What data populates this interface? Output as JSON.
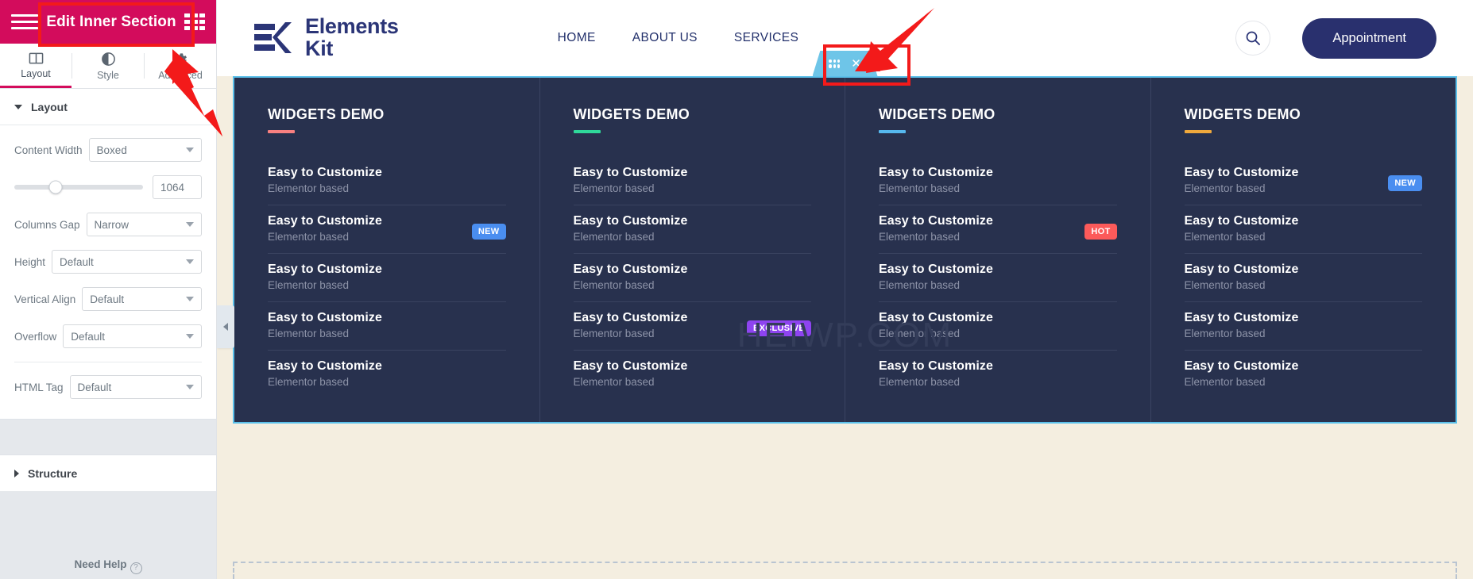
{
  "editor": {
    "header": {
      "title": "Edit Inner Section",
      "menu_icon": "hamburger-icon",
      "apps_icon": "grid-apps-icon"
    },
    "tabs": [
      {
        "label": "Layout",
        "icon": "columns-icon",
        "active": true
      },
      {
        "label": "Style",
        "icon": "contrast-icon",
        "active": false
      },
      {
        "label": "Advanced",
        "icon": "gear-icon",
        "active": false
      }
    ],
    "sections": [
      {
        "label": "Layout",
        "expanded": true
      },
      {
        "label": "Structure",
        "expanded": false
      }
    ],
    "controls": {
      "content_width": {
        "label": "Content Width",
        "value": "Boxed"
      },
      "width_slider": {
        "value": "1064",
        "percent": 32
      },
      "columns_gap": {
        "label": "Columns Gap",
        "value": "Narrow"
      },
      "height": {
        "label": "Height",
        "value": "Default"
      },
      "vertical_align": {
        "label": "Vertical Align",
        "value": "Default"
      },
      "overflow": {
        "label": "Overflow",
        "value": "Default"
      },
      "html_tag": {
        "label": "HTML Tag",
        "value": "Default"
      }
    },
    "need_help": "Need Help",
    "collapse_handle": "chevron-left-icon"
  },
  "site": {
    "logo": {
      "line1": "Elements",
      "line2": "Kit"
    },
    "nav": [
      {
        "label": "HOME"
      },
      {
        "label": "ABOUT US"
      },
      {
        "label": "SERVICES"
      }
    ],
    "search_icon": "search-icon",
    "cta": "Appointment"
  },
  "section_handle": {
    "drag_icon": "drag-dots-icon",
    "close_icon": "close-x-icon"
  },
  "watermark": "HEIWP.COM",
  "colors": {
    "editor_pink": "#d30c5c",
    "section_bg": "#28314e",
    "section_outline": "#5bc0ea",
    "handle_blue": "#6ec5e8",
    "brand_navy": "#29306e",
    "canvas_bg": "#f4eee0",
    "badge_new": "#4a8ef0",
    "badge_hot": "#fc5a5a",
    "badge_exclusive": "#8e44f0",
    "annotation_red": "#f31a1a"
  },
  "columns": [
    {
      "title": "WIDGETS DEMO",
      "underline": "#f88080",
      "items": [
        {
          "title": "Easy to Customize",
          "subtitle": "Elementor based",
          "badge": null
        },
        {
          "title": "Easy to Customize",
          "subtitle": "Elementor based",
          "badge": "NEW",
          "badge_color": "#4a8ef0"
        },
        {
          "title": "Easy to Customize",
          "subtitle": "Elementor based",
          "badge": null
        },
        {
          "title": "Easy to Customize",
          "subtitle": "Elementor based",
          "badge": null
        },
        {
          "title": "Easy to Customize",
          "subtitle": "Elementor based",
          "badge": null
        }
      ]
    },
    {
      "title": "WIDGETS DEMO",
      "underline": "#2fd89a",
      "items": [
        {
          "title": "Easy to Customize",
          "subtitle": "Elementor based",
          "badge": null
        },
        {
          "title": "Easy to Customize",
          "subtitle": "Elementor based",
          "badge": null
        },
        {
          "title": "Easy to Customize",
          "subtitle": "Elementor based",
          "badge": null
        },
        {
          "title": "Easy to Customize",
          "subtitle": "Elementor based",
          "badge": "EXCLUSIVE",
          "badge_color": "#8e44f0"
        },
        {
          "title": "Easy to Customize",
          "subtitle": "Elementor based",
          "badge": null
        }
      ]
    },
    {
      "title": "WIDGETS DEMO",
      "underline": "#56b8ee",
      "items": [
        {
          "title": "Easy to Customize",
          "subtitle": "Elementor based",
          "badge": null
        },
        {
          "title": "Easy to Customize",
          "subtitle": "Elementor based",
          "badge": "HOT",
          "badge_color": "#fc5a5a"
        },
        {
          "title": "Easy to Customize",
          "subtitle": "Elementor based",
          "badge": null
        },
        {
          "title": "Easy to Customize",
          "subtitle": "Elementor based",
          "badge": null
        },
        {
          "title": "Easy to Customize",
          "subtitle": "Elementor based",
          "badge": null
        }
      ]
    },
    {
      "title": "WIDGETS DEMO",
      "underline": "#f0a93c",
      "items": [
        {
          "title": "Easy to Customize",
          "subtitle": "Elementor based",
          "badge": "NEW",
          "badge_color": "#4a8ef0"
        },
        {
          "title": "Easy to Customize",
          "subtitle": "Elementor based",
          "badge": null
        },
        {
          "title": "Easy to Customize",
          "subtitle": "Elementor based",
          "badge": null
        },
        {
          "title": "Easy to Customize",
          "subtitle": "Elementor based",
          "badge": null
        },
        {
          "title": "Easy to Customize",
          "subtitle": "Elementor based",
          "badge": null
        }
      ]
    }
  ]
}
